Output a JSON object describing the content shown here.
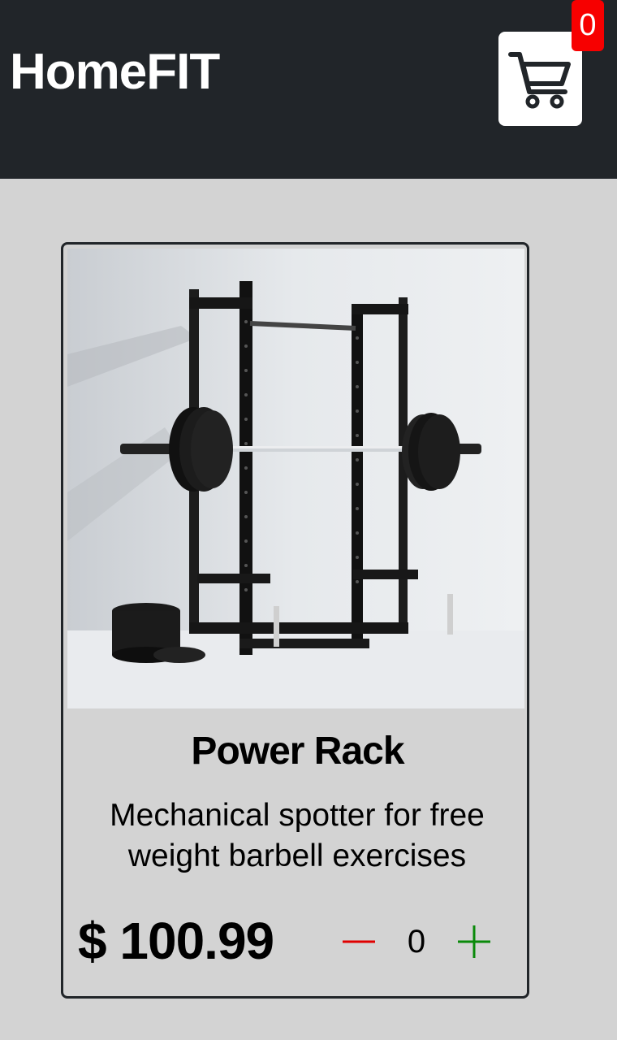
{
  "header": {
    "brand": "HomeFIT",
    "cart_count": "0",
    "cart_icon": "shopping-cart-icon"
  },
  "product": {
    "title": "Power Rack",
    "description": "Mechanical spotter for free weight barbell exercises",
    "price": "$ 100.99",
    "quantity": "0",
    "minus_icon": "minus-icon",
    "plus_icon": "plus-icon"
  },
  "colors": {
    "header_bg": "#212529",
    "page_bg": "#d3d3d3",
    "badge": "#f70000",
    "minus": "#e00000",
    "plus": "#0a8a0a"
  }
}
